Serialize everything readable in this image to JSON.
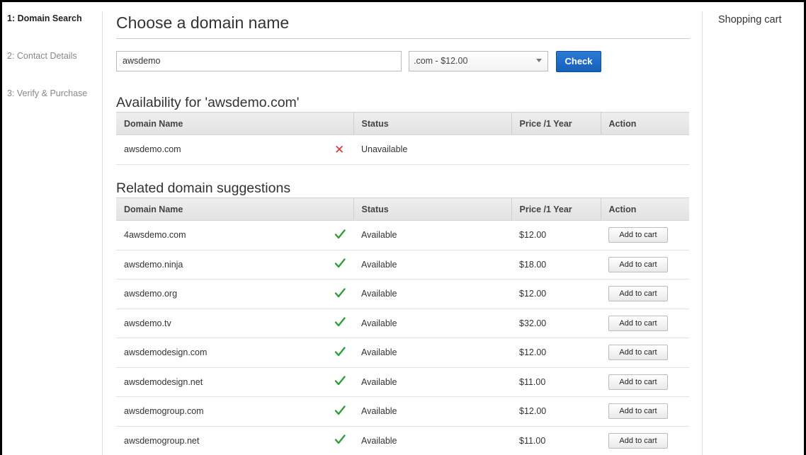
{
  "steps": [
    {
      "label": "1: Domain Search",
      "active": true
    },
    {
      "label": "2: Contact Details",
      "active": false
    },
    {
      "label": "3: Verify & Purchase",
      "active": false
    }
  ],
  "cart": {
    "title": "Shopping cart"
  },
  "header": {
    "title": "Choose a domain name"
  },
  "search": {
    "value": "awsdemo",
    "tld_selected": ".com - $12.00",
    "check_label": "Check"
  },
  "availability": {
    "title": "Availability for 'awsdemo.com'",
    "columns": [
      "Domain Name",
      "",
      "Status",
      "Price /1 Year",
      "Action"
    ],
    "rows": [
      {
        "domain": "awsdemo.com",
        "status": "Unavailable",
        "icon": "x-icon"
      }
    ]
  },
  "related": {
    "title": "Related domain suggestions",
    "columns": [
      "Domain Name",
      "",
      "Status",
      "Price /1 Year",
      "Action"
    ],
    "action_label": "Add to cart",
    "rows": [
      {
        "domain": "4awsdemo.com",
        "status": "Available",
        "price": "$12.00"
      },
      {
        "domain": "awsdemo.ninja",
        "status": "Available",
        "price": "$18.00"
      },
      {
        "domain": "awsdemo.org",
        "status": "Available",
        "price": "$12.00"
      },
      {
        "domain": "awsdemo.tv",
        "status": "Available",
        "price": "$32.00"
      },
      {
        "domain": "awsdemodesign.com",
        "status": "Available",
        "price": "$12.00"
      },
      {
        "domain": "awsdemodesign.net",
        "status": "Available",
        "price": "$11.00"
      },
      {
        "domain": "awsdemogroup.com",
        "status": "Available",
        "price": "$12.00"
      },
      {
        "domain": "awsdemogroup.net",
        "status": "Available",
        "price": "$11.00"
      }
    ]
  },
  "colors": {
    "check_button": "#1a68c4",
    "available_icon": "#2e9e3a",
    "unavailable_icon": "#d9342b"
  }
}
